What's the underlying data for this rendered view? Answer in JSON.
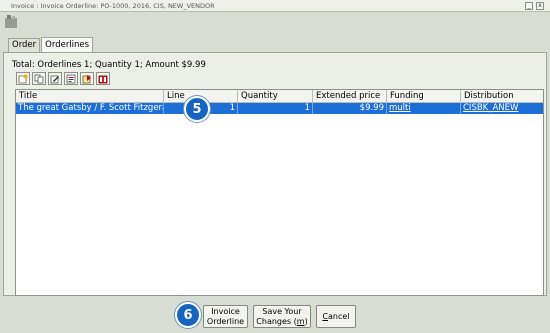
{
  "window": {
    "title": "Invoice : Invoice Orderline: PO-1000, 2016, CIS, NEW_VENDOR",
    "minimize": "_",
    "close": "x"
  },
  "tabs": [
    {
      "label": "Order"
    },
    {
      "label": "Orderlines"
    }
  ],
  "totals": {
    "text": "Total:  Orderlines 1;  Quantity 1;  Amount $9.99"
  },
  "toolbar": {
    "icons": [
      "new-orderline-icon",
      "copy-icon",
      "edit-icon",
      "details-icon",
      "move-icon",
      "delete-icon"
    ]
  },
  "grid": {
    "columns": [
      "Title",
      "Line",
      "Quantity",
      "Extended price",
      "Funding",
      "Distribution"
    ],
    "rows": [
      {
        "title": "The great Gatsby / F. Scott Fitzgerald.",
        "line": "1",
        "quantity": "1",
        "extended_price": "$9.99",
        "funding": "multi",
        "distribution": "CISBK_ANEW"
      }
    ]
  },
  "callouts": [
    "5",
    "6"
  ],
  "buttons": {
    "invoice_l1": "Invoice",
    "invoice_l2": "Orderline",
    "save_l1": "Save Your",
    "save_l2a": "Changes (",
    "save_l2b": "m",
    "save_l2c": ")",
    "cancel_a": "C",
    "cancel_b": "ancel"
  },
  "colors": {
    "selection": "#1d6fd8",
    "callout": "#1565c0"
  }
}
